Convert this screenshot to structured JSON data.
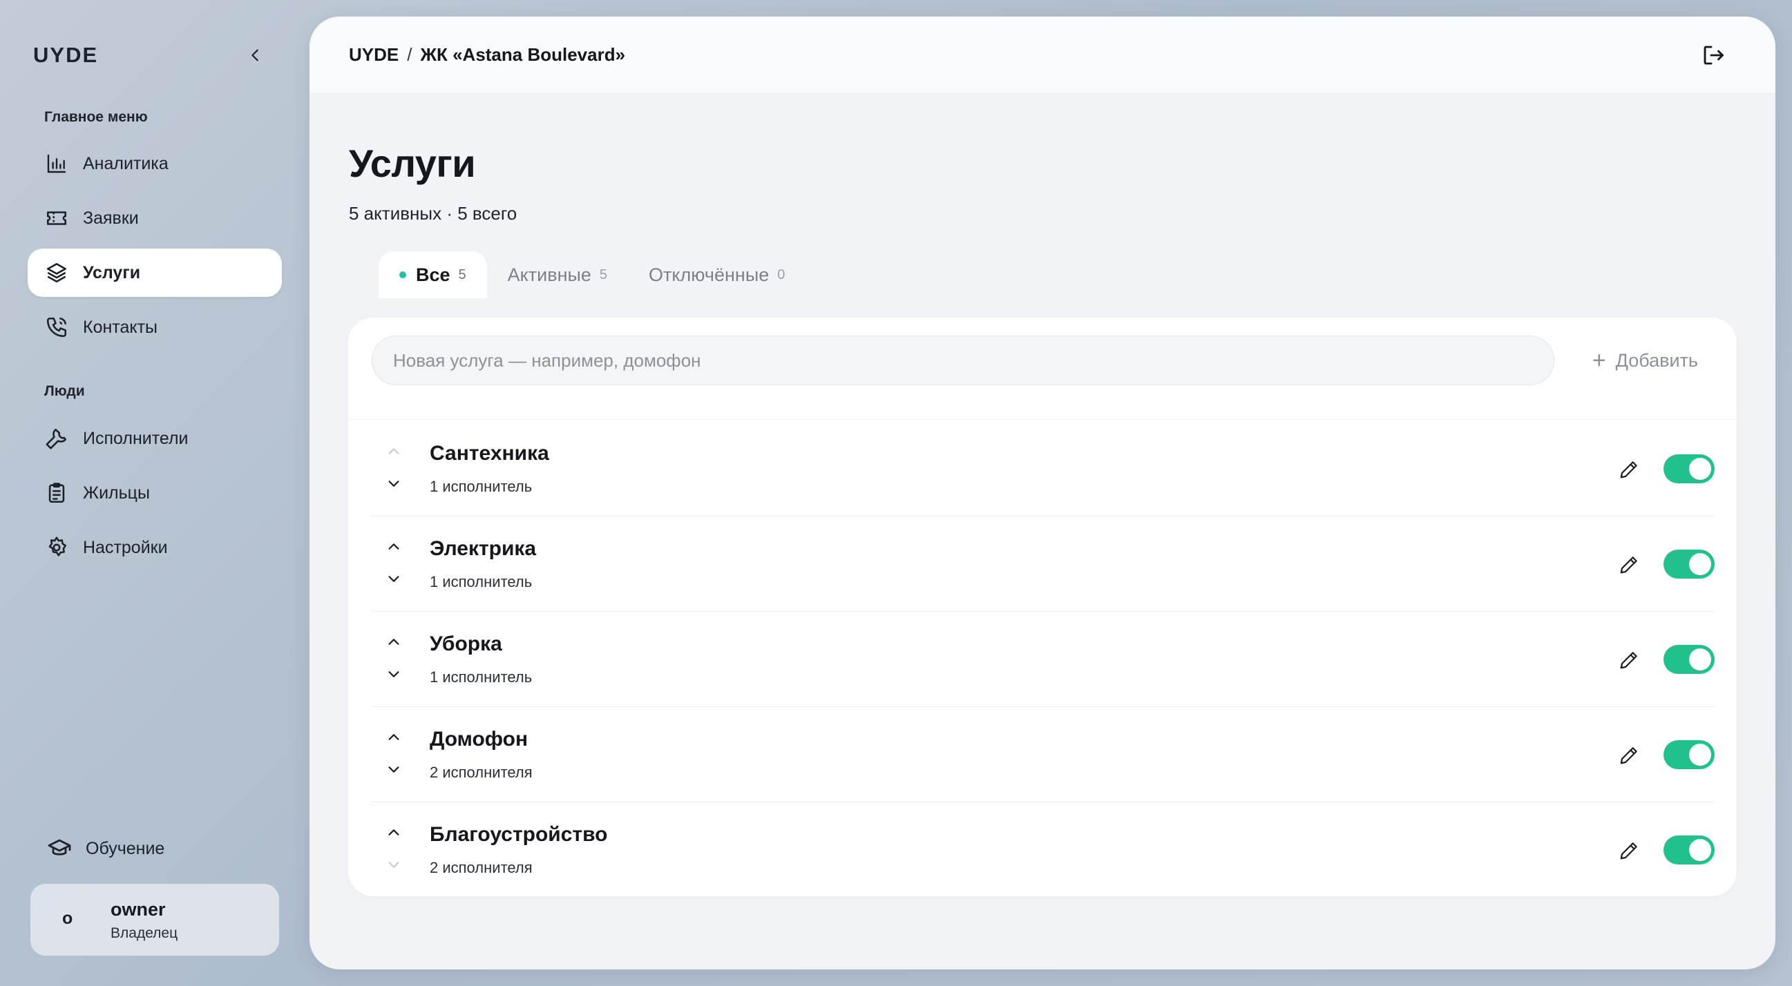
{
  "sidebar": {
    "brand": "UYDE",
    "sections": {
      "main": "Главное меню",
      "people": "Люди"
    },
    "items": [
      {
        "label": "Аналитика",
        "icon": "bar-chart-icon"
      },
      {
        "label": "Заявки",
        "icon": "ticket-icon"
      },
      {
        "label": "Услуги",
        "icon": "layers-icon",
        "active": true
      },
      {
        "label": "Контакты",
        "icon": "phone-icon"
      },
      {
        "label": "Исполнители",
        "icon": "wrench-icon"
      },
      {
        "label": "Жильцы",
        "icon": "clipboard-icon"
      },
      {
        "label": "Настройки",
        "icon": "gear-icon"
      }
    ],
    "learning": {
      "label": "Обучение",
      "icon": "graduation-cap-icon"
    },
    "user": {
      "avatar": "o",
      "name": "owner",
      "role": "Владелец"
    }
  },
  "header": {
    "breadcrumb": [
      "UYDE",
      "/",
      "ЖК «Astana Boulevard»"
    ]
  },
  "page": {
    "title": "Услуги",
    "subtitle": "5 активных · 5 всего"
  },
  "tabs": [
    {
      "label": "Все",
      "count": "5",
      "active": true
    },
    {
      "label": "Активные",
      "count": "5"
    },
    {
      "label": "Отключённые",
      "count": "0"
    }
  ],
  "add_form": {
    "placeholder": "Новая услуга — например, домофон",
    "button_label": "Добавить",
    "button_icon": "+"
  },
  "services": [
    {
      "name": "Сантехника",
      "meta": "1 исполнитель",
      "enabled": true,
      "up_disabled": true,
      "down_disabled": false
    },
    {
      "name": "Электрика",
      "meta": "1 исполнитель",
      "enabled": true,
      "up_disabled": false,
      "down_disabled": false
    },
    {
      "name": "Уборка",
      "meta": "1 исполнитель",
      "enabled": true,
      "up_disabled": false,
      "down_disabled": false
    },
    {
      "name": "Домофон",
      "meta": "2 исполнителя",
      "enabled": true,
      "up_disabled": false,
      "down_disabled": false
    },
    {
      "name": "Благоустройство",
      "meta": "2 исполнителя",
      "enabled": true,
      "up_disabled": false,
      "down_disabled": true
    }
  ],
  "colors": {
    "accent": "#22c08c",
    "tab_dot": "#26bfa0",
    "text": "#15171c",
    "muted": "#8c9199"
  }
}
